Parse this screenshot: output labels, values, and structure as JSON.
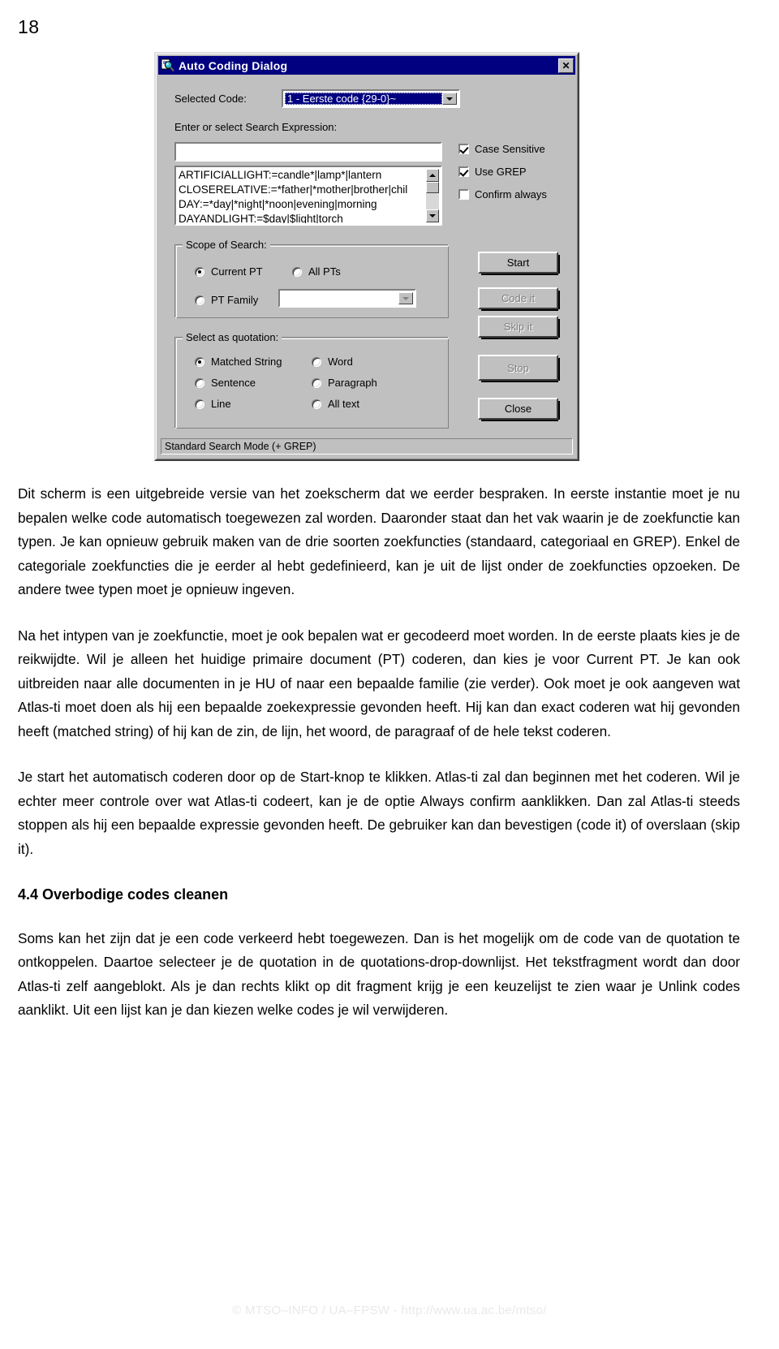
{
  "page": {
    "number": "18",
    "footer": "© MTSO–INFO / UA–FPSW -  http://www.ua.ac.be/mtso/"
  },
  "dialog": {
    "title": "Auto Coding Dialog",
    "icon": "magnifier-document-icon",
    "close_label": "✕",
    "selected_code": {
      "label": "Selected Code:",
      "value": "1 - Eerste code {29-0}~"
    },
    "search_expression": {
      "label": "Enter or select Search Expression:",
      "input_value": "",
      "items": [
        "ARTIFICIALLIGHT:=candle*|lamp*|lantern",
        "CLOSERELATIVE:=*father|*mother|brother|chil",
        "DAY:=*day|*night|*noon|evening|morning",
        "DAYANDLIGHT:=$day|$light|torch"
      ]
    },
    "options": [
      {
        "label": "Case Sensitive",
        "accel": "C",
        "checked": true
      },
      {
        "label": "Use GREP",
        "accel": "G",
        "checked": true
      },
      {
        "label": "Confirm always",
        "accel": "",
        "checked": false
      }
    ],
    "scope": {
      "title": "Scope of Search:",
      "options": [
        {
          "label": "Current PT",
          "selected": true
        },
        {
          "label": "All PTs",
          "selected": false
        },
        {
          "label": "PT Family",
          "selected": false
        }
      ],
      "family_value": ""
    },
    "quotation": {
      "title": "Select as quotation:",
      "options": [
        {
          "label": "Matched String",
          "selected": true
        },
        {
          "label": "Word",
          "selected": false
        },
        {
          "label": "Sentence",
          "selected": false
        },
        {
          "label": "Paragraph",
          "selected": false
        },
        {
          "label": "Line",
          "selected": false
        },
        {
          "label": "All text",
          "selected": false
        }
      ]
    },
    "buttons": [
      {
        "label": "Start",
        "accel": "a",
        "enabled": true
      },
      {
        "label": "Code it",
        "accel": "o",
        "enabled": false
      },
      {
        "label": "Skip it",
        "accel": "p",
        "enabled": false
      },
      {
        "label": "Stop",
        "accel": "S",
        "enabled": false
      },
      {
        "label": "Close",
        "accel": "",
        "enabled": true
      }
    ],
    "status": "Standard Search Mode (+ GREP)"
  },
  "body": {
    "p1": "Dit scherm is een uitgebreide versie van het zoekscherm dat we eerder bespraken. In eerste instantie moet je nu bepalen welke code automatisch toegewezen zal worden. Daaronder staat dan het vak waarin je de zoekfunctie kan typen. Je kan opnieuw gebruik maken van de drie soorten zoekfuncties (standaard, categoriaal en GREP). Enkel de categoriale zoekfuncties die je eerder al hebt gedefinieerd, kan je uit de lijst onder de zoekfuncties opzoeken. De andere twee typen moet je opnieuw ingeven.",
    "p2": "Na het intypen van je zoekfunctie, moet je ook bepalen wat er gecodeerd moet worden. In de eerste plaats kies je de reikwijdte. Wil je alleen het huidige primaire document (PT) coderen, dan kies je voor Current PT. Je kan ook uitbreiden naar alle documenten in je HU of naar een bepaalde familie (zie verder). Ook moet je ook aangeven wat Atlas-ti moet doen als hij een bepaalde zoekexpressie gevonden heeft. Hij kan dan exact coderen wat hij gevonden heeft (matched string) of hij kan de zin, de lijn, het woord, de paragraaf of de hele tekst coderen.",
    "p3": "Je start het automatisch coderen door op de Start-knop te klikken. Atlas-ti zal dan beginnen met het coderen. Wil je echter meer controle over wat Atlas-ti codeert, kan je de optie Always confirm aanklikken. Dan zal Atlas-ti steeds stoppen als hij een bepaalde expressie gevonden heeft. De gebruiker kan dan bevestigen (code it) of overslaan (skip it).",
    "heading": "4.4 Overbodige codes cleanen",
    "p4": "Soms kan het zijn dat je een code verkeerd hebt toegewezen. Dan is het mogelijk om de code van de quotation te ontkoppelen. Daartoe selecteer je de quotation in de quotations-drop-downlijst. Het tekstfragment wordt dan door Atlas-ti zelf aangeblokt. Als je dan rechts klikt op dit fragment krijg je een keuzelijst te zien waar je Unlink codes aanklikt. Uit een lijst kan je dan kiezen welke codes je wil verwijderen."
  }
}
